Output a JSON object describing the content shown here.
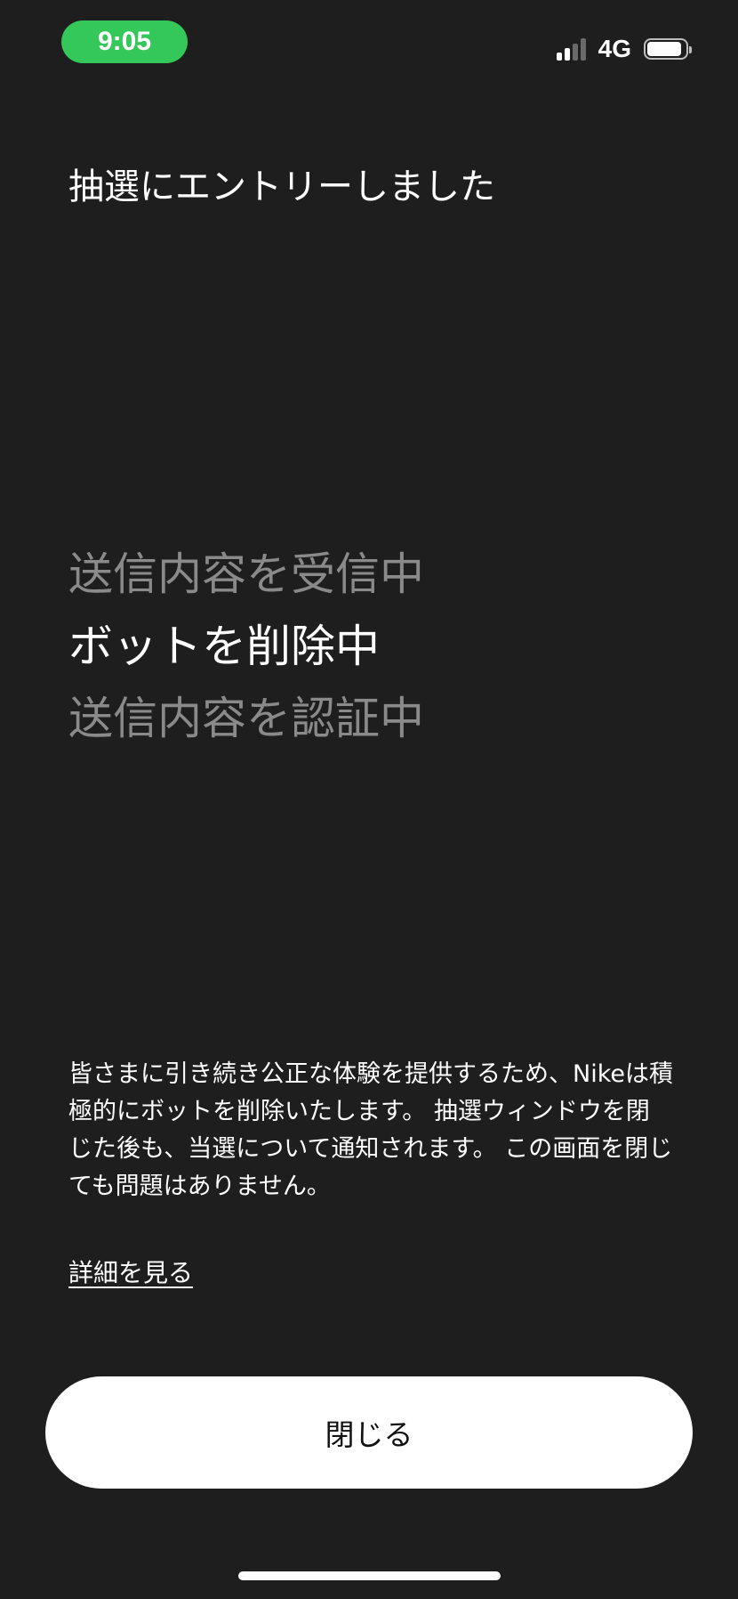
{
  "status_bar": {
    "time": "9:05",
    "network": "4G",
    "battery_level": 0.9
  },
  "title": "抽選にエントリーしました",
  "steps": [
    {
      "label": "送信内容を受信中",
      "state": "inactive"
    },
    {
      "label": "ボットを削除中",
      "state": "active"
    },
    {
      "label": "送信内容を認証中",
      "state": "inactive"
    }
  ],
  "info_text": "皆さまに引き続き公正な体験を提供するため、Nikeは積極的にボットを削除いたします。 抽選ウィンドウを閉じた後も、当選について通知されます。 この画面を閉じても問題はありません。",
  "more_link": "詳細を見る",
  "close_button": "閉じる",
  "colors": {
    "background": "#1e1e1e",
    "time_pill": "#34c759",
    "active_text": "#ffffff",
    "inactive_text": "#8a8a8a",
    "button_bg": "#ffffff",
    "button_text": "#111111"
  }
}
